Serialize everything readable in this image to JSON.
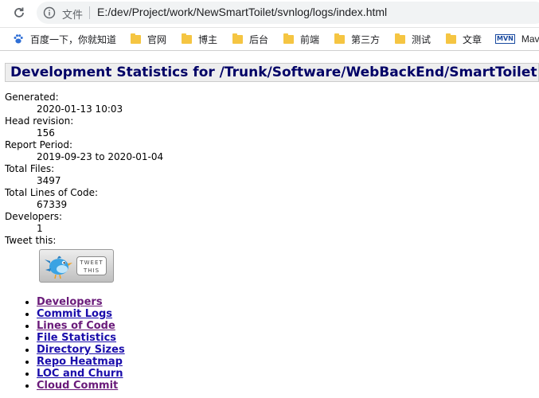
{
  "browser": {
    "scheme_label": "文件",
    "url": "E:/dev/Project/work/NewSmartToilet/svnlog/logs/index.html",
    "bookmarks": [
      {
        "label": "百度一下，你就知道",
        "icon": "paw-icon"
      },
      {
        "label": "官网",
        "icon": "folder-icon"
      },
      {
        "label": "博主",
        "icon": "folder-icon"
      },
      {
        "label": "后台",
        "icon": "folder-icon"
      },
      {
        "label": "前端",
        "icon": "folder-icon"
      },
      {
        "label": "第三方",
        "icon": "folder-icon"
      },
      {
        "label": "测试",
        "icon": "folder-icon"
      },
      {
        "label": "文章",
        "icon": "folder-icon"
      },
      {
        "label": "Mave",
        "icon": "mvn-icon",
        "icon_text": "MVN"
      }
    ]
  },
  "page": {
    "title": "Development Statistics for /Trunk/Software/WebBackEnd/SmartToilet",
    "stats": [
      {
        "label": "Generated:",
        "value": "2020-01-13 10:03"
      },
      {
        "label": "Head revision:",
        "value": "156"
      },
      {
        "label": "Report Period:",
        "value": "2019-09-23 to 2020-01-04"
      },
      {
        "label": "Total Files:",
        "value": "3497"
      },
      {
        "label": "Total Lines of Code:",
        "value": "67339"
      },
      {
        "label": "Developers:",
        "value": "1"
      }
    ],
    "tweet_label": "Tweet this:",
    "tweet_button": {
      "line1": "TWEET",
      "line2": "THIS"
    },
    "nav_links": [
      {
        "label": "Developers",
        "visited": true
      },
      {
        "label": "Commit Logs",
        "visited": false
      },
      {
        "label": "Lines of Code",
        "visited": true
      },
      {
        "label": "File Statistics",
        "visited": false
      },
      {
        "label": "Directory Sizes",
        "visited": false
      },
      {
        "label": "Repo Heatmap",
        "visited": false
      },
      {
        "label": "LOC and Churn",
        "visited": false
      },
      {
        "label": "Cloud Commit",
        "visited": true
      }
    ]
  },
  "colors": {
    "title_text": "#000066",
    "link": "#1a0dab",
    "visited_link": "#6a1b7a",
    "folder": "#f5c542"
  }
}
